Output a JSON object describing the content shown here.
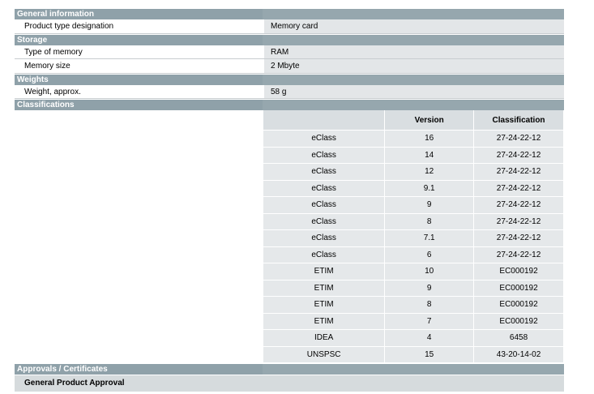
{
  "general": {
    "title": "General information",
    "rows": [
      {
        "label": "Product type designation",
        "value": "Memory card"
      }
    ]
  },
  "storage": {
    "title": "Storage",
    "rows": [
      {
        "label": "Type of memory",
        "value": "RAM"
      },
      {
        "label": "Memory size",
        "value": "2 Mbyte"
      }
    ]
  },
  "weights": {
    "title": "Weights",
    "rows": [
      {
        "label": "Weight, approx.",
        "value": "58 g"
      }
    ]
  },
  "classifications": {
    "title": "Classifications",
    "headers": [
      "",
      "Version",
      "Classification"
    ],
    "rows": [
      [
        "eClass",
        "16",
        "27-24-22-12"
      ],
      [
        "eClass",
        "14",
        "27-24-22-12"
      ],
      [
        "eClass",
        "12",
        "27-24-22-12"
      ],
      [
        "eClass",
        "9.1",
        "27-24-22-12"
      ],
      [
        "eClass",
        "9",
        "27-24-22-12"
      ],
      [
        "eClass",
        "8",
        "27-24-22-12"
      ],
      [
        "eClass",
        "7.1",
        "27-24-22-12"
      ],
      [
        "eClass",
        "6",
        "27-24-22-12"
      ],
      [
        "ETIM",
        "10",
        "EC000192"
      ],
      [
        "ETIM",
        "9",
        "EC000192"
      ],
      [
        "ETIM",
        "8",
        "EC000192"
      ],
      [
        "ETIM",
        "7",
        "EC000192"
      ],
      [
        "IDEA",
        "4",
        "6458"
      ],
      [
        "UNSPSC",
        "15",
        "43-20-14-02"
      ]
    ]
  },
  "approvals": {
    "title": "Approvals / Certificates",
    "subtitle": "General Product Approval"
  }
}
